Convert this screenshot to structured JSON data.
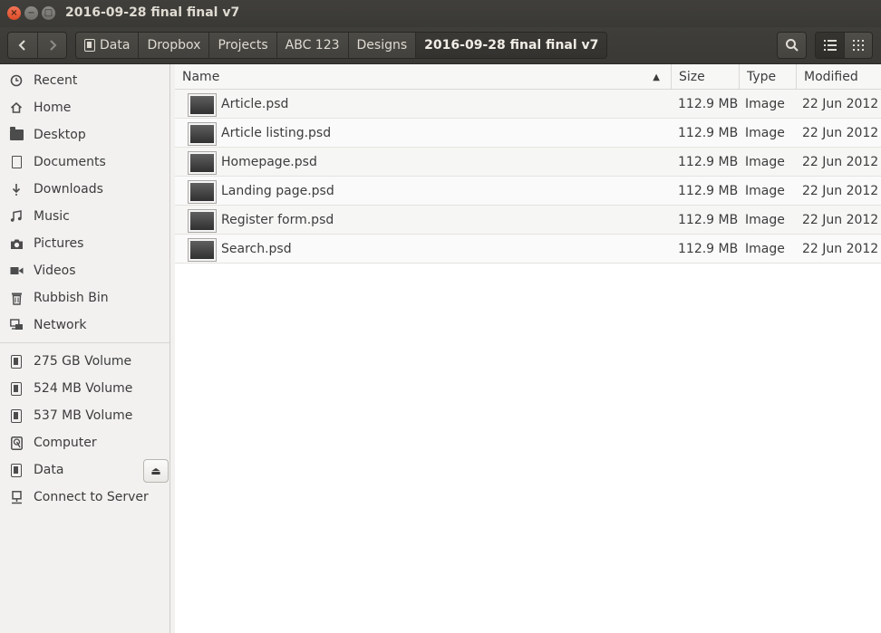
{
  "window": {
    "title": "2016-09-28 final final v7",
    "close_glyph": "×",
    "minimize_glyph": "−",
    "maximize_glyph": "□"
  },
  "toolbar": {
    "back_icon": "chevron-left-icon",
    "forward_icon": "chevron-right-icon",
    "breadcrumbs": [
      {
        "label": "Data",
        "icon": "drive-icon"
      },
      {
        "label": "Dropbox"
      },
      {
        "label": "Projects"
      },
      {
        "label": "ABC 123"
      },
      {
        "label": "Designs"
      },
      {
        "label": "2016-09-28 final final v7",
        "current": true
      }
    ],
    "search_icon": "search-icon",
    "list_view_icon": "list-view-icon",
    "grid_view_icon": "grid-view-icon"
  },
  "sidebar": {
    "places": [
      {
        "label": "Recent",
        "icon": "clock-icon"
      },
      {
        "label": "Home",
        "icon": "home-icon"
      },
      {
        "label": "Desktop",
        "icon": "folder-icon"
      },
      {
        "label": "Documents",
        "icon": "document-icon"
      },
      {
        "label": "Downloads",
        "icon": "download-icon"
      },
      {
        "label": "Music",
        "icon": "music-icon"
      },
      {
        "label": "Pictures",
        "icon": "camera-icon"
      },
      {
        "label": "Videos",
        "icon": "video-icon"
      },
      {
        "label": "Rubbish Bin",
        "icon": "trash-icon"
      },
      {
        "label": "Network",
        "icon": "network-icon"
      }
    ],
    "devices": [
      {
        "label": "275 GB Volume",
        "icon": "drive-icon"
      },
      {
        "label": "524 MB Volume",
        "icon": "drive-icon"
      },
      {
        "label": "537 MB Volume",
        "icon": "drive-icon"
      },
      {
        "label": "Computer",
        "icon": "computer-icon"
      },
      {
        "label": "Data",
        "icon": "drive-icon",
        "eject": true
      },
      {
        "label": "Connect to Server",
        "icon": "server-icon"
      }
    ],
    "eject_glyph": "⏏"
  },
  "columns": {
    "name": "Name",
    "size": "Size",
    "type": "Type",
    "modified": "Modified",
    "sort_glyph": "▲"
  },
  "files": [
    {
      "name": "Article.psd",
      "size": "112.9 MB",
      "type": "Image",
      "modified": "22 Jun 2012"
    },
    {
      "name": "Article listing.psd",
      "size": "112.9 MB",
      "type": "Image",
      "modified": "22 Jun 2012"
    },
    {
      "name": "Homepage.psd",
      "size": "112.9 MB",
      "type": "Image",
      "modified": "22 Jun 2012"
    },
    {
      "name": "Landing page.psd",
      "size": "112.9 MB",
      "type": "Image",
      "modified": "22 Jun 2012"
    },
    {
      "name": "Register form.psd",
      "size": "112.9 MB",
      "type": "Image",
      "modified": "22 Jun 2012"
    },
    {
      "name": "Search.psd",
      "size": "112.9 MB",
      "type": "Image",
      "modified": "22 Jun 2012"
    }
  ]
}
